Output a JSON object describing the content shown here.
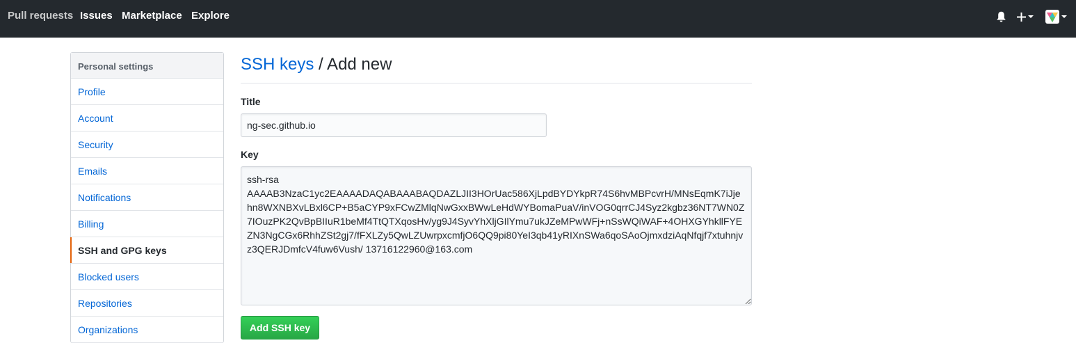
{
  "header": {
    "nav": [
      {
        "label": "Pull requests"
      },
      {
        "label": "Issues"
      },
      {
        "label": "Marketplace"
      },
      {
        "label": "Explore"
      }
    ],
    "icons": [
      "bell-icon",
      "plus-icon",
      "avatar"
    ],
    "background": "#24292e"
  },
  "sidebar": {
    "heading": "Personal settings",
    "items": [
      {
        "label": "Profile"
      },
      {
        "label": "Account"
      },
      {
        "label": "Security"
      },
      {
        "label": "Emails"
      },
      {
        "label": "Notifications"
      },
      {
        "label": "Billing"
      },
      {
        "label": "SSH and GPG keys",
        "selected": true
      },
      {
        "label": "Blocked users"
      },
      {
        "label": "Repositories"
      },
      {
        "label": "Organizations"
      }
    ],
    "accent_color": "#e36209"
  },
  "main": {
    "breadcrumb_link": "SSH keys",
    "breadcrumb_rest": " / Add new",
    "title_label": "Title",
    "title_value": "ng-sec.github.io",
    "key_label": "Key",
    "key_value": "ssh-rsa\nAAAAB3NzaC1yc2EAAAADAQABAAABAQDAZLJII3HOrUac586XjLpdBYDYkpR74S6hvMBPcvrH/MNsEqmK7iJjehn8WXNBXvLBxl6CP+B5aCYP9xFCwZMlqNwGxxBWwLeHdWYBomaPuaV/inVOG0qrrCJ4Syz2kgbz36NT7WN0Z7IOuzPK2QvBpBIIuR1beMf4TtQTXqosHv/yg9J4SyvYhXljGIlYmu7ukJZeMPwWFj+nSsWQiWAF+4OHXGYhkllFYEZN3NgCGx6RhhZSt2gj7/fFXLZy5QwLZUwrpxcmfjO6QQ9pi80YeI3qb41yRIXnSWa6qoSAoOjmxdziAqNfqjf7xtuhnjvz3QERJDmfcV4fuw6Vush/ 13716122960@163.com",
    "submit_label": "Add SSH key",
    "link_color": "#0366d6",
    "button_color": "#28a745"
  }
}
